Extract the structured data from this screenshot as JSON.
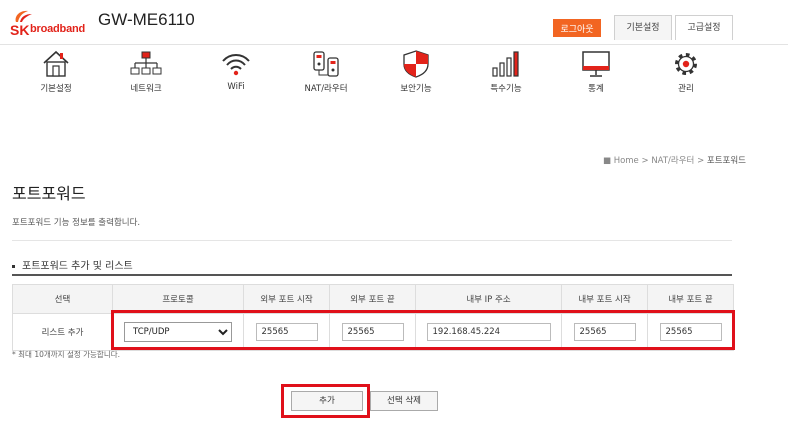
{
  "header": {
    "logo_sk": "SK",
    "logo_broadband": "broadband",
    "model": "GW-ME6110",
    "logout_label": "로그아웃",
    "tab_basic": "기본설정",
    "tab_advanced": "고급설정",
    "accent_color": "#f26522"
  },
  "menu": [
    {
      "label": "기본설정",
      "icon": "home-icon"
    },
    {
      "label": "네트워크",
      "icon": "network-icon"
    },
    {
      "label": "WiFi",
      "icon": "wifi-icon"
    },
    {
      "label": "NAT/라우터",
      "icon": "nat-router-icon"
    },
    {
      "label": "보안기능",
      "icon": "shield-icon"
    },
    {
      "label": "특수기능",
      "icon": "bar-chart-icon"
    },
    {
      "label": "통계",
      "icon": "monitor-icon"
    },
    {
      "label": "관리",
      "icon": "gear-icon"
    }
  ],
  "breadcrumb": {
    "home": "Home",
    "parent": "NAT/라우터",
    "current": "포트포워드"
  },
  "page": {
    "title": "포트포워드",
    "description": "포트포워드 기능 정보를 출력합니다.",
    "section_title": "포트포워드 추가 및 리스트"
  },
  "table": {
    "headers": [
      "선택",
      "프로토콜",
      "외부 포트 시작",
      "외부 포트 끝",
      "내부 IP 주소",
      "내부 포트 시작",
      "내부 포트 끝"
    ],
    "row": {
      "label": "리스트 추가",
      "protocol": "TCP/UDP",
      "protocol_options": [
        "TCP/UDP"
      ],
      "ext_port_start": "25565",
      "ext_port_end": "25565",
      "internal_ip": "192.168.45.224",
      "int_port_start": "25565",
      "int_port_end": "25565"
    }
  },
  "note": "* 최대 10개까지 설정 가능합니다.",
  "buttons": {
    "add": "추가",
    "delete_selected": "선택 삭제"
  },
  "highlight_color": "#e0101a"
}
